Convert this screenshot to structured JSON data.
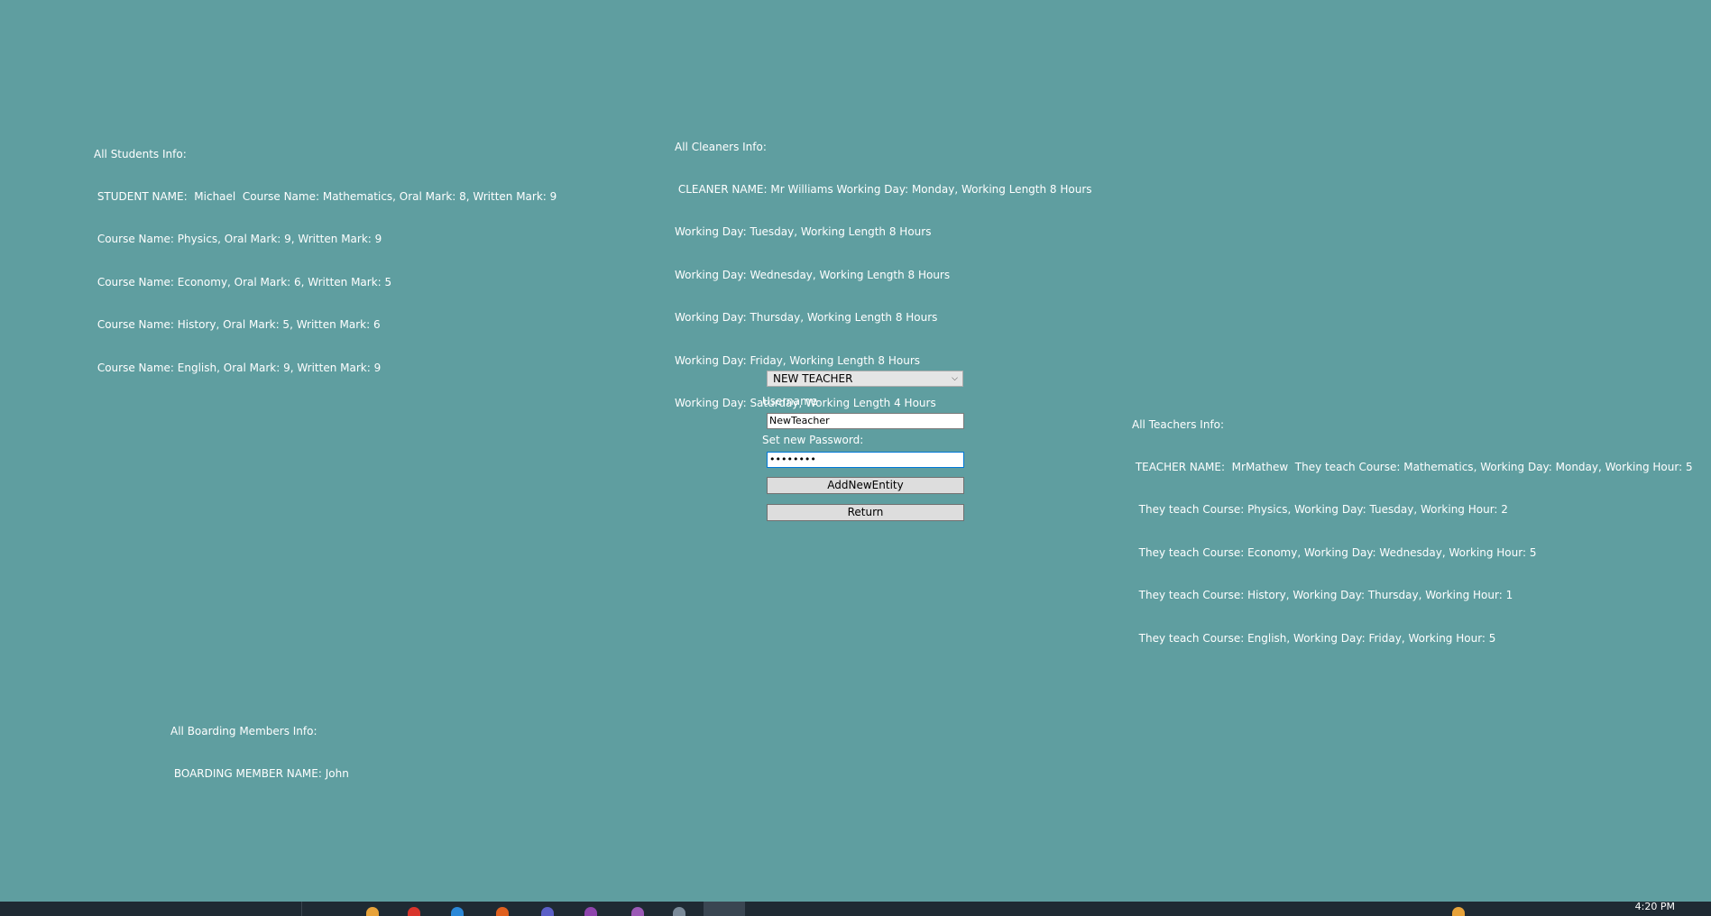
{
  "students": {
    "lines": [
      "All Students Info:",
      " STUDENT NAME:  Michael  Course Name: Mathematics, Oral Mark: 8, Written Mark: 9",
      " Course Name: Physics, Oral Mark: 9, Written Mark: 9",
      " Course Name: Economy, Oral Mark: 6, Written Mark: 5",
      " Course Name: History, Oral Mark: 5, Written Mark: 6",
      " Course Name: English, Oral Mark: 9, Written Mark: 9"
    ]
  },
  "cleaners": {
    "lines": [
      "All Cleaners Info:",
      " CLEANER NAME: Mr Williams Working Day: Monday, Working Length 8 Hours",
      "Working Day: Tuesday, Working Length 8 Hours",
      "Working Day: Wednesday, Working Length 8 Hours",
      "Working Day: Thursday, Working Length 8 Hours",
      "Working Day: Friday, Working Length 8 Hours",
      "Working Day: Saturday, Working Length 4 Hours"
    ]
  },
  "teachers": {
    "lines": [
      "All Teachers Info:",
      " TEACHER NAME:  MrMathew  They teach Course: Mathematics, Working Day: Monday, Working Hour: 5",
      "  They teach Course: Physics, Working Day: Tuesday, Working Hour: 2",
      "  They teach Course: Economy, Working Day: Wednesday, Working Hour: 5",
      "  They teach Course: History, Working Day: Thursday, Working Hour: 1",
      "  They teach Course: English, Working Day: Friday, Working Hour: 5"
    ]
  },
  "boarding": {
    "lines": [
      "All Boarding Members Info:",
      " BOARDING MEMBER NAME: John"
    ]
  },
  "form": {
    "entity_type_selected": "NEW TEACHER",
    "username_label": "Username",
    "username_value": "NewTeacher",
    "password_label": "Set new Password:",
    "password_value": "••••••••",
    "add_button_label": "AddNewEntity",
    "return_button_label": "Return"
  },
  "taskbar": {
    "clock": "4:20 PM",
    "icon_colors": [
      "#e8a33a",
      "#d9342b",
      "#2b88d8",
      "#e0601e",
      "#5b5fc7",
      "#8e44ad",
      "#9b59b6",
      "#7a8a99"
    ]
  },
  "colors": {
    "background": "#5f9ea0",
    "text": "#ffffff"
  }
}
